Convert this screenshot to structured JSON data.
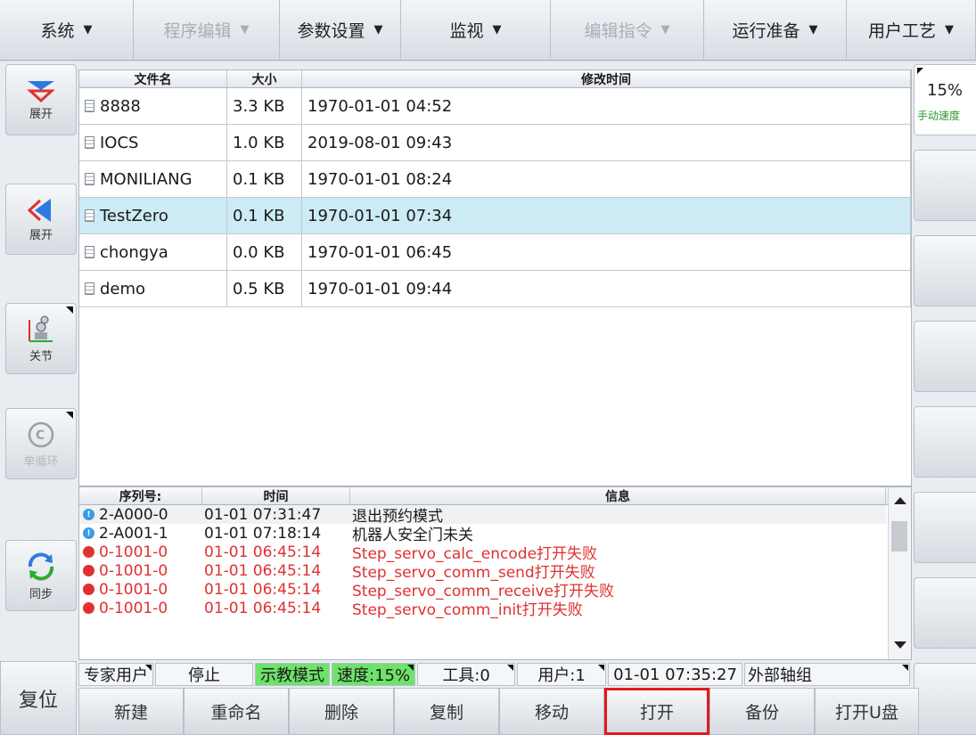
{
  "menubar": [
    {
      "label": "系统",
      "caret": "▼",
      "disabled": false
    },
    {
      "label": "程序编辑",
      "caret": "▼",
      "disabled": true
    },
    {
      "label": "参数设置",
      "caret": "▼",
      "disabled": false
    },
    {
      "label": "监视",
      "caret": "▼",
      "disabled": false
    },
    {
      "label": "编辑指令",
      "caret": "▼",
      "disabled": true
    },
    {
      "label": "运行准备",
      "caret": "▼",
      "disabled": false
    },
    {
      "label": "用户工艺",
      "caret": "▼",
      "disabled": false
    }
  ],
  "left_buttons": [
    {
      "label": "展开",
      "icon": "double-chevron-down-icon"
    },
    {
      "label": "展开",
      "icon": "double-chevron-left-icon"
    },
    {
      "label": "关节",
      "icon": "robot-joint-icon"
    },
    {
      "label": "单循环",
      "icon": "single-cycle-icon"
    },
    {
      "label": "同步",
      "icon": "sync-icon"
    }
  ],
  "reset_label": "复位",
  "speed": {
    "value": "15%",
    "label": "手动速度"
  },
  "file_table": {
    "headers": [
      "文件名",
      "大小",
      "修改时间"
    ],
    "rows": [
      {
        "name": "8888",
        "size": "3.3 KB",
        "time": "1970-01-01 04:52"
      },
      {
        "name": "IOCS",
        "size": "1.0 KB",
        "time": "2019-08-01 09:43"
      },
      {
        "name": "MONILIANG",
        "size": "0.1 KB",
        "time": "1970-01-01 08:24"
      },
      {
        "name": "TestZero",
        "size": "0.1 KB",
        "time": "1970-01-01 07:34"
      },
      {
        "name": "chongya",
        "size": "0.0 KB",
        "time": "1970-01-01 06:45"
      },
      {
        "name": "demo",
        "size": "0.5 KB",
        "time": "1970-01-01 09:44"
      }
    ],
    "selected_index": 3
  },
  "log_table": {
    "headers": [
      "序列号:",
      "时间",
      "信息"
    ],
    "rows": [
      {
        "type": "info",
        "id": "2-A000-0",
        "time": "01-01 07:31:47",
        "msg": "退出预约模式"
      },
      {
        "type": "info",
        "id": "2-A001-1",
        "time": "01-01 07:18:14",
        "msg": "机器人安全门未关"
      },
      {
        "type": "error",
        "id": "0-1001-0",
        "time": "01-01 06:45:14",
        "msg": "Step_servo_calc_encode打开失败"
      },
      {
        "type": "error",
        "id": "0-1001-0",
        "time": "01-01 06:45:14",
        "msg": "Step_servo_comm_send打开失败"
      },
      {
        "type": "error",
        "id": "0-1001-0",
        "time": "01-01 06:45:14",
        "msg": "Step_servo_comm_receive打开失败"
      },
      {
        "type": "error",
        "id": "0-1001-0",
        "time": "01-01 06:45:14",
        "msg": "Step_servo_comm_init打开失败"
      }
    ]
  },
  "status_bar": [
    {
      "label": "专家用户",
      "green": false,
      "corner": true
    },
    {
      "label": "停止",
      "green": false,
      "corner": false
    },
    {
      "label": "示教模式",
      "green": true,
      "corner": false
    },
    {
      "label": "速度:15%",
      "green": true,
      "corner": true
    },
    {
      "label": "工具:0",
      "green": false,
      "corner": true
    },
    {
      "label": "用户:1",
      "green": false,
      "corner": true
    },
    {
      "label": "01-01 07:35:27",
      "green": false,
      "corner": false
    },
    {
      "label": "外部轴组",
      "green": false,
      "corner": true
    }
  ],
  "bottom_buttons": [
    "新建",
    "重命名",
    "删除",
    "复制",
    "移动",
    "打开",
    "备份",
    "打开U盘"
  ],
  "active_bottom_button": "打开",
  "colors": {
    "selected_row": "#cdebf4",
    "error": "#e0302f",
    "info": "#3a9be6",
    "green_status": "#6de36a",
    "active_border": "#e3181b"
  }
}
